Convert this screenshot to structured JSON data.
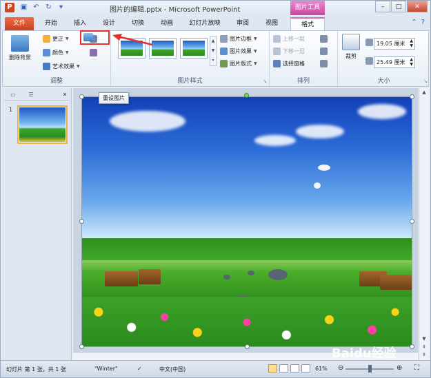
{
  "window": {
    "title": "图片的编辑.pptx - Microsoft PowerPoint",
    "context_tool": "图片工具",
    "app_icon": "P"
  },
  "tabs": [
    {
      "label": "文件"
    },
    {
      "label": "开始"
    },
    {
      "label": "插入"
    },
    {
      "label": "设计"
    },
    {
      "label": "切换"
    },
    {
      "label": "动画"
    },
    {
      "label": "幻灯片放映"
    },
    {
      "label": "审阅"
    },
    {
      "label": "视图"
    },
    {
      "label": "格式"
    }
  ],
  "ribbon": {
    "adjust": {
      "remove_bg": "删除背景",
      "corrections": "更正",
      "color": "颜色",
      "artistic": "艺术效果",
      "group_label": "调整"
    },
    "styles": {
      "border": "图片边框",
      "effects": "图片效果",
      "layout": "图片版式",
      "group_label": "图片样式"
    },
    "arrange": {
      "bring_forward": "上移一层",
      "send_backward": "下移一层",
      "selection_pane": "选择窗格",
      "group_label": "排列"
    },
    "size": {
      "crop": "裁剪",
      "height": "19.05 厘米",
      "width": "25.49 厘米",
      "group_label": "大小"
    }
  },
  "tooltip": "重设图片",
  "thumbnail": {
    "number": "1"
  },
  "status": {
    "slide_info": "幻灯片 第 1 张，共 1 张",
    "theme": "\"Winter\"",
    "language": "中文(中国)",
    "zoom": "61%"
  },
  "watermark": "Baidu经验",
  "colors": {
    "file_tab": "#c8431d",
    "context_tab": "#c8479f",
    "highlight": "#e53030"
  }
}
